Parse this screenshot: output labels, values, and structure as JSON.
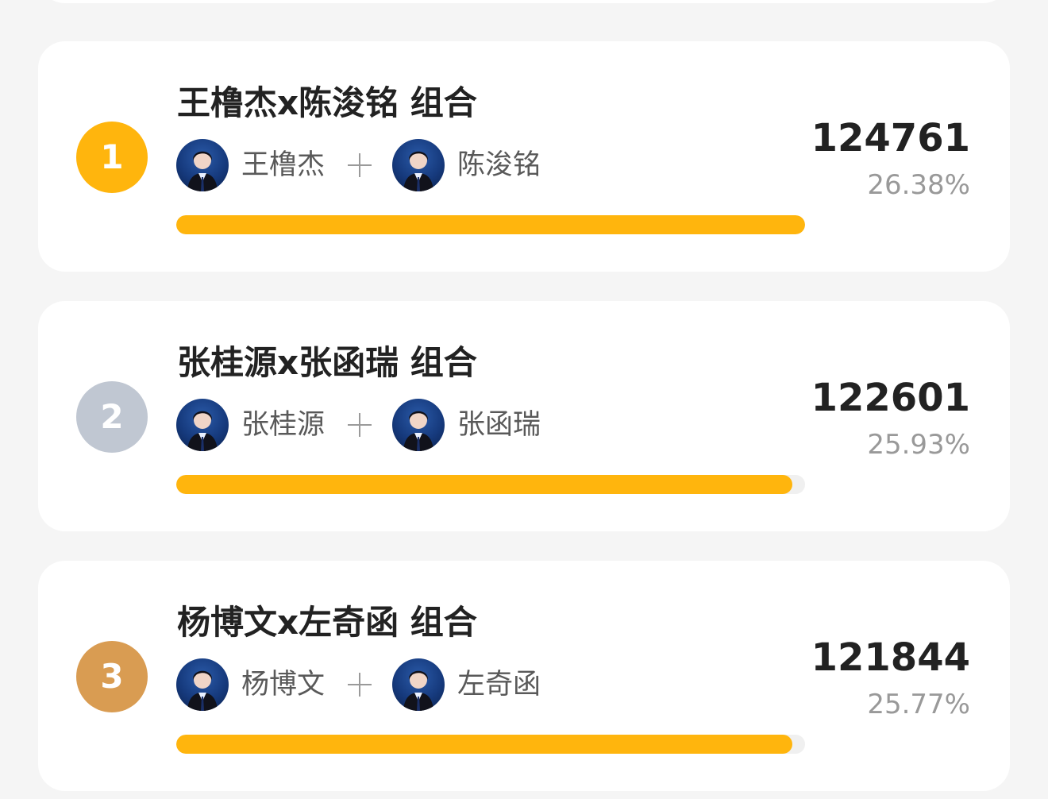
{
  "colors": {
    "rank_gold": "#ffb50d",
    "rank_silver": "#c0c7d2",
    "rank_bronze": "#d99c52",
    "progress_bar": "#ffb50d",
    "avatar_background": "#163a7d"
  },
  "entries": [
    {
      "rank": "1",
      "title": "王橹杰x陈浚铭 组合",
      "member1": "王橹杰",
      "member2": "陈浚铭",
      "votes": "124761",
      "percent": "26.38%",
      "progress_fraction": 1.0
    },
    {
      "rank": "2",
      "title": "张桂源x张函瑞 组合",
      "member1": "张桂源",
      "member2": "张函瑞",
      "votes": "122601",
      "percent": "25.93%",
      "progress_fraction": 0.98
    },
    {
      "rank": "3",
      "title": "杨博文x左奇函 组合",
      "member1": "杨博文",
      "member2": "左奇函",
      "votes": "121844",
      "percent": "25.77%",
      "progress_fraction": 0.98
    }
  ]
}
